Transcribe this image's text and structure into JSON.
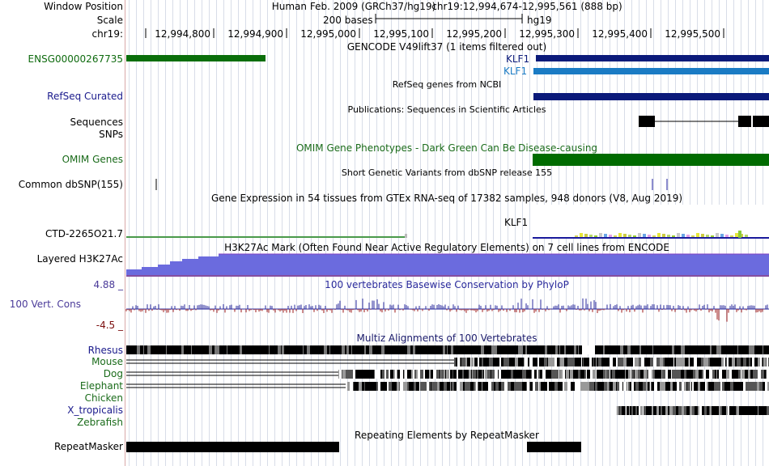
{
  "header": {
    "window_position_label": "Window Position",
    "scale_label": "Scale",
    "chrom_label": "chr19:",
    "assembly": "Human Feb. 2009 (GRCh37/hg19)",
    "position": "chr19:12,994,674-12,995,561 (888 bp)",
    "scale_text": "200 bases",
    "db": "hg19",
    "ruler_ticks": [
      "12,994,800",
      "12,994,900",
      "12,995,000",
      "12,995,100",
      "12,995,200",
      "12,995,300",
      "12,995,400",
      "12,995,500"
    ]
  },
  "tracks": {
    "gencode": {
      "title": "GENCODE V49lift37 (1 items filtered out)",
      "gene_left": "ENSG00000267735",
      "gene_right_1": "KLF1",
      "gene_right_2": "KLF1"
    },
    "refseq": {
      "title": "RefSeq genes from NCBI",
      "label": "RefSeq Curated"
    },
    "publications": {
      "title": "Publications: Sequences in Scientific Articles",
      "label_1": "Sequences",
      "label_2": "SNPs"
    },
    "omim": {
      "title": "OMIM Gene Phenotypes - Dark Green Can Be Disease-causing",
      "label": "OMIM Genes"
    },
    "dbsnp": {
      "title": "Short Genetic Variants from dbSNP release 155",
      "label": "Common dbSNP(155)"
    },
    "gtex": {
      "title": "Gene Expression in 54 tissues from GTEx RNA-seq of 17382 samples, 948 donors (V8, Aug 2019)",
      "gene": "KLF1",
      "label": "CTD-2265O21.7"
    },
    "h3k27ac": {
      "title": "H3K27Ac Mark (Often Found Near Active Regulatory Elements) on 7 cell lines from ENCODE",
      "label": "Layered H3K27Ac"
    },
    "phylop": {
      "title": "100 vertebrates Basewise Conservation by PhyloP",
      "max": "4.88 _",
      "label": "100 Vert. Cons",
      "min": "-4.5 _"
    },
    "multiz": {
      "title": "Multiz Alignments of 100 Vertebrates",
      "species": [
        "Rhesus",
        "Mouse",
        "Dog",
        "Elephant",
        "Chicken",
        "X_tropicalis",
        "Zebrafish"
      ]
    },
    "repeatmasker": {
      "title": "Repeating Elements by RepeatMasker",
      "label": "RepeatMasker"
    }
  },
  "colors": {
    "gencode_green": "#006400",
    "klf1_navy": "#0b1a7a",
    "klf1_blue": "#1a7bc4",
    "omim_green": "#006b00",
    "h3k27ac_fill": "#6b6bde",
    "phylop_blue": "#2a2a9c",
    "phylop_red": "#9c1a1a"
  }
}
